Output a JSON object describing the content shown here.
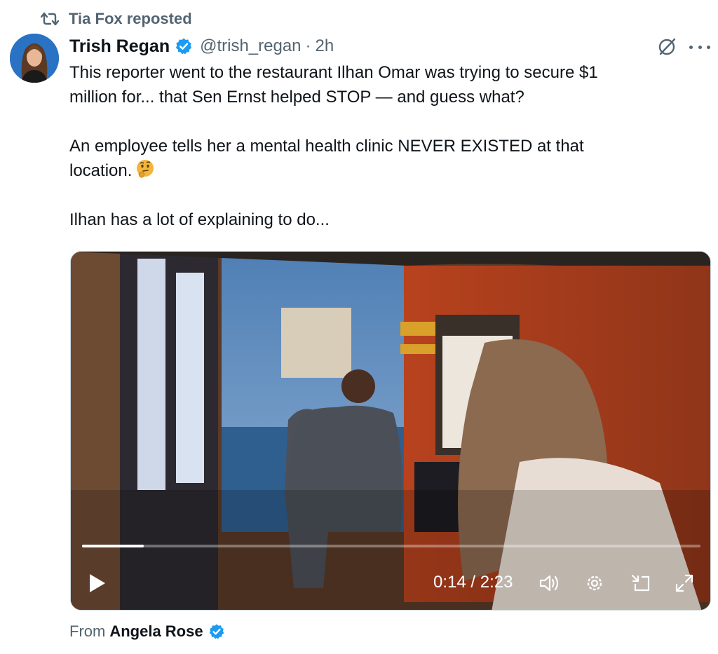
{
  "repost": {
    "text": "Tia Fox reposted",
    "icon": "repost-icon"
  },
  "tweet": {
    "author_name": "Trish Regan",
    "handle": "@trish_regan",
    "separator": "·",
    "time": "2h",
    "verified": true,
    "text_line1": "This reporter went to the restaurant Ilhan Omar was trying to secure $1\nmillion for... that Sen Ernst helped STOP — and guess what?",
    "text_line2": "An employee tells her a mental health clinic NEVER EXISTED at that\nlocation.",
    "text_line3": "Ilhan has a lot of explaining to do..."
  },
  "video": {
    "current_time": "0:14",
    "duration": "2:23",
    "progress": 0.1,
    "time_display": "0:14 / 2:23"
  },
  "attribution": {
    "prefix": "From",
    "name": "Angela Rose"
  },
  "colors": {
    "verified_blue": "#1d9bf0",
    "secondary_text": "#536471",
    "primary_text": "#0f1419"
  }
}
